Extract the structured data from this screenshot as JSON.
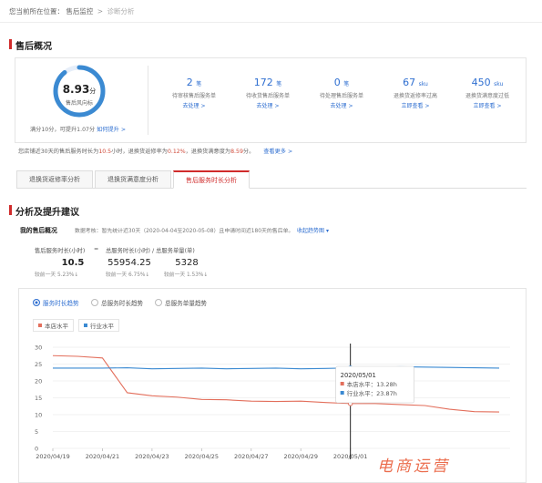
{
  "breadcrumb": {
    "prefix": "您当前所在位置：",
    "parent": "售后监控",
    "sep": ">",
    "current": "诊断分析"
  },
  "overview": {
    "title": "售后概况",
    "score": "8.93",
    "score_unit": "分",
    "score_label": "售后风向标",
    "score_note": "满分10分，可提升1.07分",
    "score_link": "如何提升 >",
    "gauge_fraction": 0.893,
    "stats": [
      {
        "value": "2",
        "unit": "笔",
        "label": "待审核售后服务单",
        "action": "去处理 >"
      },
      {
        "value": "172",
        "unit": "笔",
        "label": "待收货售后服务单",
        "action": "去处理 >"
      },
      {
        "value": "0",
        "unit": "笔",
        "label": "待处理售后服务单",
        "action": "去处理 >"
      },
      {
        "value": "67",
        "unit": "sku",
        "label": "退换货返修率过高",
        "action": "立即查看 >"
      },
      {
        "value": "450",
        "unit": "sku",
        "label": "退换货满意度过低",
        "action": "立即查看 >"
      }
    ],
    "summary_pre": "您店铺近30天的售后服务时长为",
    "summary_hours": "10.5",
    "summary_mid1": "小时，退换货返修率为",
    "summary_rate": "0.12%",
    "summary_mid2": "，退换货满意度为",
    "summary_sat": "8.59",
    "summary_end": "分。",
    "summary_link": "查看更多 >"
  },
  "tabs": [
    {
      "label": "退换货返修率分析"
    },
    {
      "label": "退换货满意度分析"
    },
    {
      "label": "售后服务时长分析"
    }
  ],
  "analysis": {
    "title": "分析及提升建议",
    "subtitle": "我的售后概况",
    "note": "数据考核：暂先统计近30天（2020-04-04至2020-05-08）且申请时间近180天的售后单。",
    "collapse": "收起趋势图",
    "metric1_label": "售后服务时长(小时)",
    "eq": "=",
    "metric2_label": "总服务时长(小时) / 总服务单量(单)",
    "m1": "10.5",
    "m2": "55954.25",
    "m3": "5328",
    "m1_cmp": "较前一天 5.23%↓",
    "m2_cmp": "较前一天 6.75%↓",
    "m3_cmp": "较前一天 1.53%↓"
  },
  "chart_controls": {
    "radios": [
      "服务时长趋势",
      "总服务时长趋势",
      "总服务单量趋势"
    ],
    "legend": [
      {
        "name": "本店水平",
        "color": "#e36f5c"
      },
      {
        "name": "行业水平",
        "color": "#3b8ad2"
      }
    ]
  },
  "chart_data": {
    "type": "line",
    "ylim": [
      0,
      30
    ],
    "yticks": [
      "0",
      "5",
      "10",
      "15",
      "20",
      "25",
      "30"
    ],
    "xtick_labels": [
      "2020/04/19",
      "2020/04/21",
      "2020/04/23",
      "2020/04/25",
      "2020/04/27",
      "2020/04/29",
      "2020/05/01"
    ],
    "x": [
      "04/19",
      "04/20",
      "04/21",
      "04/22",
      "04/23",
      "04/24",
      "04/25",
      "04/26",
      "04/27",
      "04/28",
      "04/29",
      "04/30",
      "05/01",
      "05/02",
      "05/03",
      "05/04",
      "05/05",
      "05/06",
      "05/07"
    ],
    "series": [
      {
        "name": "本店水平",
        "color": "#e36f5c",
        "values": [
          27.5,
          27.3,
          26.8,
          16.5,
          15.6,
          15.2,
          14.5,
          14.4,
          14.0,
          13.9,
          14.0,
          13.6,
          13.28,
          13.3,
          13.0,
          12.7,
          11.6,
          10.9,
          10.8
        ]
      },
      {
        "name": "行业水平",
        "color": "#3b8ad2",
        "values": [
          23.8,
          23.8,
          23.8,
          23.9,
          23.6,
          23.7,
          23.8,
          23.6,
          23.7,
          23.8,
          23.6,
          23.7,
          23.87,
          24.0,
          24.2,
          24.1,
          24.0,
          23.9,
          23.8
        ]
      }
    ],
    "tooltip": {
      "date": "2020/05/01",
      "lines": [
        "本店水平：13.28h",
        "行业水平：23.87h"
      ],
      "index": 12
    }
  },
  "watermark": "电商运营"
}
